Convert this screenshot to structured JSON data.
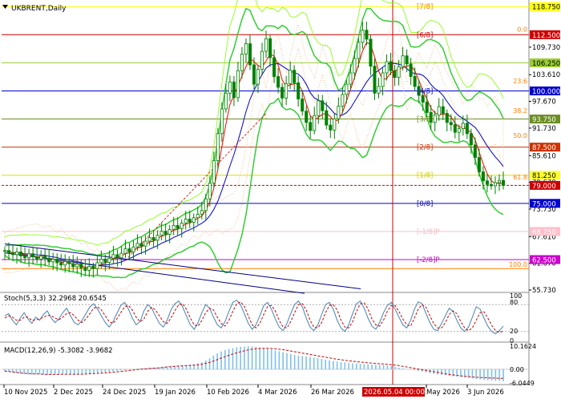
{
  "title": "UKBRENT,Daily",
  "colors": {
    "background": "#ffffff",
    "candle": "#008000",
    "ma_fast": "#ff0000",
    "ma_slow": "#0000cc",
    "bands": "#32cd32",
    "ichimoku_cloud": "#f4a460",
    "fibo": "#ff7f00",
    "murrey_blue": "#0000ff",
    "murrey_red": "#cc3300",
    "separator": "#888888"
  },
  "price_axis": {
    "ticks": [
      "109.730",
      "103.610",
      "97.670",
      "91.730",
      "85.610",
      "79.670",
      "73.730",
      "67.610",
      "61.670",
      "55.730"
    ]
  },
  "price_labels": [
    {
      "text": "118.750",
      "price": 118.75,
      "bg": "#ffff00",
      "fg": "#000000"
    },
    {
      "text": "112.500",
      "price": 112.5,
      "bg": "#cc0000",
      "fg": "#ffffff"
    },
    {
      "text": "106.250",
      "price": 106.25,
      "bg": "#9acd32",
      "fg": "#000000"
    },
    {
      "text": "100.000",
      "price": 100.0,
      "bg": "#0000cc",
      "fg": "#ffffff"
    },
    {
      "text": "93.750",
      "price": 93.75,
      "bg": "#6b8e23",
      "fg": "#ffffff"
    },
    {
      "text": "87.500",
      "price": 87.5,
      "bg": "#cc3300",
      "fg": "#ffffff"
    },
    {
      "text": "81.250",
      "price": 81.25,
      "bg": "#ffff33",
      "fg": "#000000"
    },
    {
      "text": "79.000",
      "price": 79.0,
      "bg": "#cc0000",
      "fg": "#ffffff"
    },
    {
      "text": "75.000",
      "price": 75.0,
      "bg": "#0000cc",
      "fg": "#ffffff"
    },
    {
      "text": "68.750",
      "price": 68.75,
      "bg": "#ffc0cb",
      "fg": "#ffffff"
    },
    {
      "text": "62.500",
      "price": 62.5,
      "bg": "#cc00cc",
      "fg": "#ffffff"
    }
  ],
  "murrey_labels": [
    {
      "text": "[7/8]",
      "price": 118.75,
      "color": "#ff7f00"
    },
    {
      "text": "[6/8]",
      "price": 112.5,
      "color": "#cc0000"
    },
    {
      "text": "[4/8]",
      "price": 100.0,
      "color": "#0000cc"
    },
    {
      "text": "[3/8]",
      "price": 93.75,
      "color": "#6b8e23"
    },
    {
      "text": "[2/8]",
      "price": 87.5,
      "color": "#cc3300"
    },
    {
      "text": "[1/8]",
      "price": 81.25,
      "color": "#cccc00"
    },
    {
      "text": "[0/8]",
      "price": 75.0,
      "color": "#0000cc"
    },
    {
      "text": "[-1/8]P",
      "price": 68.75,
      "color": "#ffb6c1"
    },
    {
      "text": "[-2/8]P",
      "price": 62.5,
      "color": "#cc00cc"
    }
  ],
  "fibo_labels": [
    {
      "text": "0.0",
      "price": 112.8
    },
    {
      "text": "23.6",
      "price": 101.3
    },
    {
      "text": "38.2",
      "price": 94.7
    },
    {
      "text": "50.0",
      "price": 89.2
    },
    {
      "text": "61.8",
      "price": 80.0
    },
    {
      "text": "100.0",
      "price": 60.5
    }
  ],
  "stoch": {
    "label": "Stoch(5,3,3) 32.2968 20.6545",
    "ticks": [
      "100",
      "80",
      "20",
      "0"
    ],
    "main": [
      55,
      60,
      45,
      35,
      50,
      62,
      48,
      38,
      52,
      45,
      58,
      66,
      50,
      40,
      48,
      62,
      72,
      55,
      40,
      35,
      45,
      60,
      75,
      82,
      70,
      55,
      40,
      30,
      42,
      60,
      78,
      85,
      70,
      50,
      35,
      42,
      66,
      80,
      72,
      55,
      38,
      30,
      45,
      68,
      82,
      88,
      75,
      55,
      35,
      25,
      40,
      62,
      80,
      72,
      52,
      35,
      28,
      42,
      65,
      85,
      90,
      80,
      60,
      38,
      25,
      35,
      55,
      78,
      85,
      70,
      48,
      30,
      22,
      38,
      60,
      80,
      88,
      75,
      50,
      30,
      22,
      35,
      58,
      80,
      85,
      70,
      45,
      28,
      20,
      35,
      60,
      82,
      88,
      72,
      50,
      32,
      25,
      40,
      62,
      78,
      85,
      70,
      52,
      35,
      28,
      45,
      70,
      86,
      82,
      60,
      40,
      25,
      22,
      38,
      55,
      72,
      65,
      45,
      28,
      20,
      30,
      52,
      75,
      70,
      50,
      32,
      20,
      15,
      22,
      32
    ],
    "signal": [
      50,
      55,
      52,
      45,
      45,
      52,
      52,
      45,
      46,
      48,
      52,
      56,
      55,
      50,
      46,
      52,
      60,
      62,
      55,
      45,
      40,
      48,
      60,
      72,
      75,
      68,
      55,
      42,
      38,
      48,
      62,
      75,
      78,
      68,
      52,
      42,
      48,
      65,
      74,
      68,
      55,
      42,
      38,
      50,
      66,
      80,
      82,
      70,
      50,
      35,
      32,
      45,
      62,
      72,
      68,
      52,
      38,
      32,
      45,
      65,
      82,
      86,
      76,
      55,
      35,
      28,
      38,
      58,
      76,
      78,
      66,
      45,
      30,
      28,
      42,
      62,
      80,
      82,
      68,
      45,
      30,
      28,
      40,
      62,
      78,
      80,
      68,
      45,
      30,
      28,
      42,
      65,
      82,
      84,
      70,
      48,
      35,
      32,
      45,
      65,
      78,
      78,
      65,
      48,
      35,
      32,
      50,
      70,
      80,
      74,
      55,
      38,
      28,
      28,
      40,
      58,
      66,
      60,
      42,
      28,
      22,
      28,
      45,
      62,
      64,
      50,
      34,
      22,
      18,
      21
    ]
  },
  "macd": {
    "label": "MACD(12,26,9) -5.3082 -3.9682",
    "ticks": [
      "10.1624",
      "0.00",
      "-6.0449"
    ],
    "histogram": [
      -1,
      -1.2,
      -1.5,
      -1.8,
      -2.0,
      -2.1,
      -2.3,
      -2.4,
      -2.3,
      -2.2,
      -2.4,
      -2.6,
      -2.5,
      -2.3,
      -2.2,
      -2.1,
      -2.0,
      -2.2,
      -2.4,
      -2.3,
      -2.1,
      -1.9,
      -1.8,
      -1.7,
      -1.6,
      -1.5,
      -1.4,
      -1.2,
      -1.0,
      -0.8,
      -0.6,
      -0.4,
      -0.2,
      0.0,
      0.2,
      0.3,
      0.4,
      0.5,
      0.6,
      0.7,
      0.9,
      1.1,
      1.3,
      1.5,
      1.6,
      1.6,
      1.7,
      1.8,
      2.0,
      2.2,
      2.5,
      3.0,
      3.8,
      4.8,
      6.0,
      7.0,
      7.8,
      8.4,
      8.9,
      9.3,
      9.6,
      9.8,
      10.0,
      10.1,
      10.0,
      9.8,
      9.6,
      9.3,
      9.0,
      8.7,
      8.3,
      7.9,
      7.5,
      7.1,
      6.7,
      6.3,
      6.0,
      5.8,
      5.6,
      5.4,
      5.1,
      4.8,
      4.5,
      4.2,
      3.9,
      3.6,
      3.4,
      3.2,
      3.0,
      2.8,
      2.6,
      2.5,
      2.4,
      2.3,
      2.2,
      2.1,
      2.0,
      1.9,
      1.8,
      1.6,
      1.3,
      1.0,
      0.7,
      0.4,
      0.1,
      -0.2,
      -0.5,
      -0.8,
      -1.1,
      -1.4,
      -1.7,
      -2.0,
      -2.3,
      -2.5,
      -2.7,
      -2.9,
      -3.1,
      -3.3,
      -3.5,
      -3.7,
      -3.9,
      -4.1,
      -4.3,
      -4.5,
      -4.7,
      -4.9,
      -5.0,
      -5.1,
      -5.2,
      -5.3
    ],
    "signal": [
      -0.8,
      -1.0,
      -1.2,
      -1.4,
      -1.6,
      -1.8,
      -1.9,
      -2.0,
      -2.1,
      -2.1,
      -2.2,
      -2.3,
      -2.3,
      -2.3,
      -2.3,
      -2.2,
      -2.2,
      -2.2,
      -2.2,
      -2.2,
      -2.2,
      -2.1,
      -2.0,
      -1.9,
      -1.8,
      -1.7,
      -1.6,
      -1.5,
      -1.3,
      -1.2,
      -1.0,
      -0.8,
      -0.6,
      -0.4,
      -0.2,
      0.0,
      0.1,
      0.3,
      0.4,
      0.5,
      0.6,
      0.8,
      1.0,
      1.1,
      1.3,
      1.4,
      1.5,
      1.6,
      1.7,
      1.8,
      2.0,
      2.2,
      2.6,
      3.0,
      3.6,
      4.2,
      4.9,
      5.5,
      6.1,
      6.7,
      7.2,
      7.7,
      8.1,
      8.5,
      8.8,
      9.0,
      9.1,
      9.2,
      9.2,
      9.1,
      9.0,
      8.8,
      8.6,
      8.3,
      8.0,
      7.7,
      7.4,
      7.1,
      6.8,
      6.5,
      6.2,
      5.9,
      5.6,
      5.3,
      5.0,
      4.7,
      4.4,
      4.2,
      3.9,
      3.7,
      3.5,
      3.3,
      3.1,
      3.0,
      2.8,
      2.7,
      2.6,
      2.4,
      2.3,
      2.2,
      2.0,
      1.8,
      1.6,
      1.3,
      1.0,
      0.7,
      0.4,
      0.1,
      -0.2,
      -0.5,
      -0.8,
      -1.1,
      -1.4,
      -1.7,
      -2.0,
      -2.3,
      -2.5,
      -2.7,
      -2.9,
      -3.1,
      -3.2,
      -3.4,
      -3.5,
      -3.6,
      -3.7,
      -3.8,
      -3.9,
      -3.9,
      -4.0,
      -4.0
    ]
  },
  "time_axis": {
    "labels": [
      "10 Nov 2025",
      "2 Dec 2025",
      "24 Dec 2025",
      "19 Jan 2026",
      "10 Feb 2026",
      "4 Mar 2026",
      "26 Mar 2026",
      "May 2026",
      "3 Jun 2026"
    ],
    "cursor_label": "2026.05.04 00:00"
  },
  "chart_data": {
    "type": "candlestick",
    "symbol": "UKBRENT",
    "timeframe": "Daily",
    "ylim": [
      55.73,
      119.5
    ],
    "x_range": [
      "10 Nov 2025",
      "Jun 2026"
    ],
    "closes": [
      64.5,
      64.0,
      63.6,
      64.2,
      63.3,
      62.9,
      63.8,
      63.1,
      62.6,
      63.3,
      62.8,
      62.0,
      62.6,
      61.8,
      61.3,
      62.1,
      61.6,
      60.9,
      61.5,
      60.6,
      60.1,
      61.0,
      60.5,
      61.8,
      62.6,
      61.9,
      62.8,
      63.6,
      62.9,
      63.9,
      64.9,
      64.2,
      65.3,
      66.1,
      65.5,
      66.6,
      67.4,
      66.8,
      67.9,
      68.8,
      68.1,
      69.2,
      70.1,
      69.4,
      70.6,
      71.5,
      70.8,
      71.8,
      72.6,
      73.4,
      76.0,
      79.5,
      84.5,
      90.5,
      96.0,
      99.5,
      102.0,
      98.5,
      104.5,
      108.2,
      110.5,
      105.8,
      101.5,
      104.8,
      108.8,
      111.6,
      107.4,
      103.2,
      100.8,
      98.4,
      101.6,
      104.6,
      101.8,
      98.2,
      95.5,
      93.0,
      91.2,
      94.5,
      97.8,
      95.6,
      92.4,
      91.3,
      93.8,
      96.6,
      99.2,
      101.5,
      104.0,
      107.2,
      110.8,
      113.5,
      111.5,
      105.5,
      99.5,
      101.0,
      104.0,
      106.5,
      104.5,
      103.0,
      105.4,
      107.8,
      106.0,
      103.2,
      101.0,
      99.0,
      97.5,
      95.2,
      93.0,
      94.6,
      96.5,
      95.0,
      93.0,
      92.5,
      90.8,
      91.6,
      92.8,
      90.5,
      88.0,
      85.2,
      82.0,
      80.0,
      79.2,
      78.9,
      79.6,
      80.1,
      79.0
    ]
  }
}
